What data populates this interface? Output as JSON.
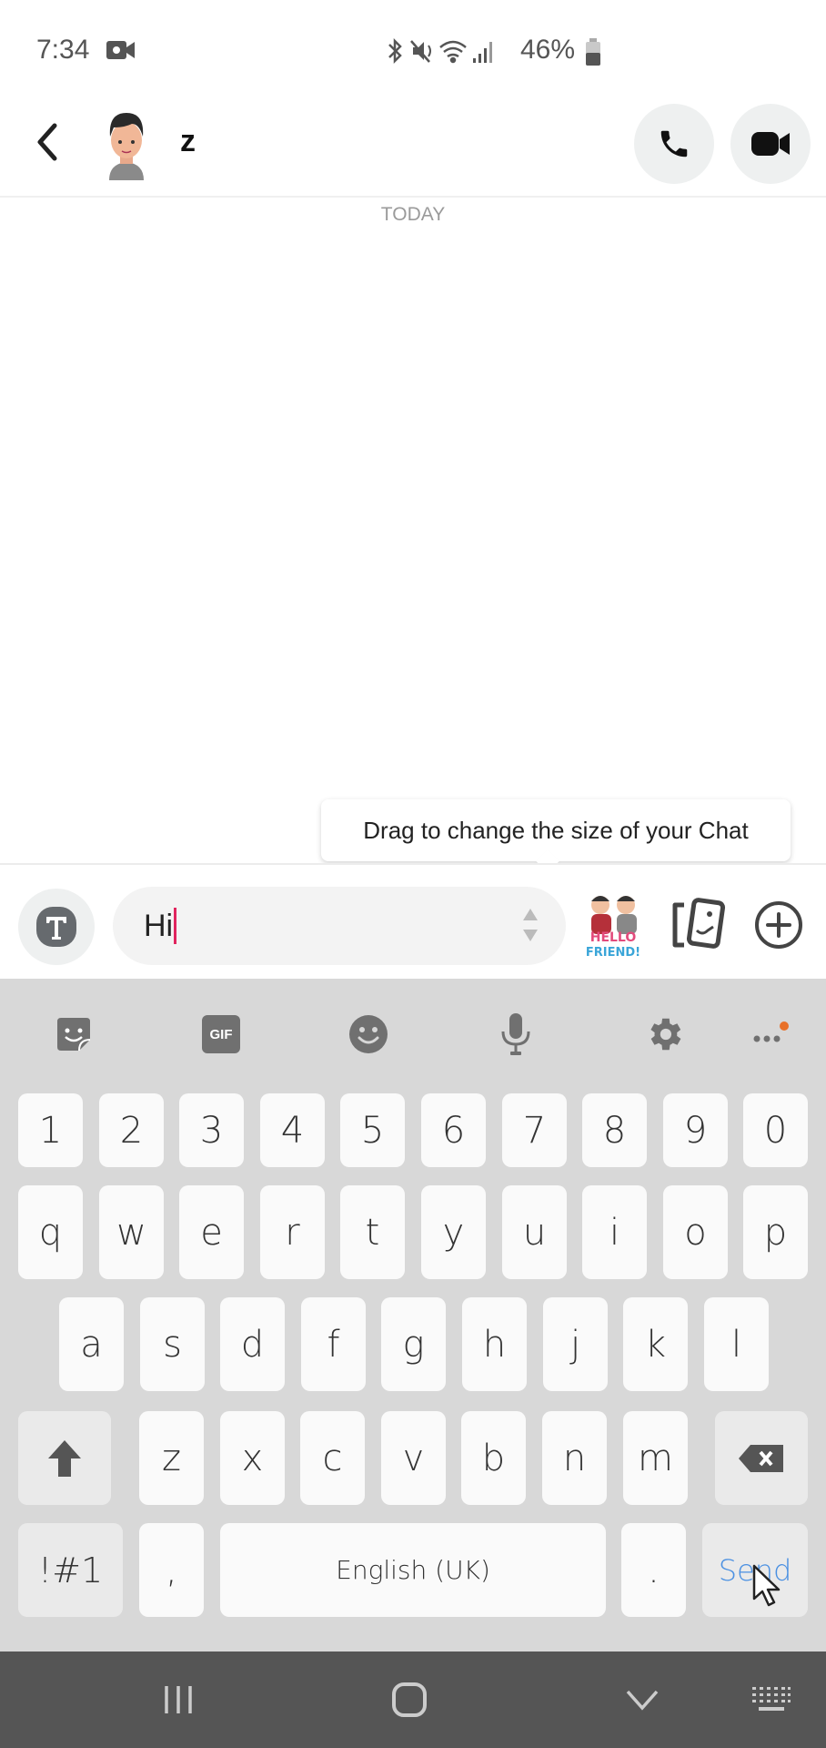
{
  "status_bar": {
    "time": "7:34",
    "battery": "46%",
    "icons": [
      "screen-record-icon",
      "bluetooth-icon",
      "mute-icon",
      "wifi-icon",
      "signal-icon",
      "battery-icon"
    ]
  },
  "header": {
    "contact_name": "z",
    "back_icon": "chevron-left-icon",
    "call_icon": "phone-icon",
    "video_icon": "video-camera-icon"
  },
  "chat": {
    "date_label": "TODAY",
    "tooltip": "Drag to change the size of your Chat"
  },
  "input_bar": {
    "message_value": "Hi",
    "sticker_text": "HELLO FRIEND!",
    "icons": [
      "text-style-icon",
      "resize-handle-icon",
      "bitmoji-sticker",
      "memories-icon",
      "plus-circle-icon"
    ]
  },
  "keyboard": {
    "toolbar": [
      "sticker-icon",
      "gif-icon",
      "emoji-icon",
      "microphone-icon",
      "settings-icon",
      "more-icon"
    ],
    "gif_label": "GIF",
    "colors": {
      "notification_dot": "#e8712a",
      "send": "#4a90e2"
    },
    "rows": {
      "numbers": [
        "1",
        "2",
        "3",
        "4",
        "5",
        "6",
        "7",
        "8",
        "9",
        "0"
      ],
      "top": [
        "q",
        "w",
        "e",
        "r",
        "t",
        "y",
        "u",
        "i",
        "o",
        "p"
      ],
      "middle": [
        "a",
        "s",
        "d",
        "f",
        "g",
        "h",
        "j",
        "k",
        "l"
      ],
      "bottom": [
        "z",
        "x",
        "c",
        "v",
        "b",
        "n",
        "m"
      ]
    },
    "symbols_label": "!#1",
    "comma_label": ",",
    "space_label": "English (UK)",
    "period_label": ".",
    "send_label": "Send"
  },
  "nav_bar": {
    "buttons": [
      "recent-apps-icon",
      "home-icon",
      "hide-keyboard-icon",
      "keyboard-switch-icon"
    ]
  }
}
